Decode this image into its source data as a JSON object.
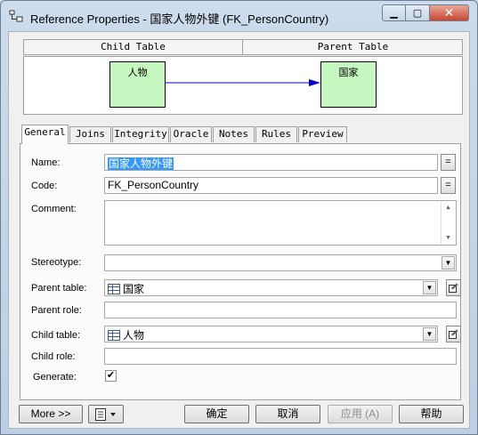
{
  "window": {
    "title": "Reference Properties - 国家人物外键 (FK_PersonCountry)",
    "minimize_glyph": "▁",
    "maximize_glyph": "▢",
    "close_glyph": "✕"
  },
  "diagram": {
    "child_header": "Child Table",
    "parent_header": "Parent Table",
    "child_entity": "人物",
    "parent_entity": "国家",
    "entity_fill": "#c6f7c0",
    "link_color": "#0000cc"
  },
  "tabs": [
    {
      "label": "General",
      "active": true
    },
    {
      "label": "Joins",
      "active": false
    },
    {
      "label": "Integrity",
      "active": false
    },
    {
      "label": "Oracle",
      "active": false
    },
    {
      "label": "Notes",
      "active": false
    },
    {
      "label": "Rules",
      "active": false
    },
    {
      "label": "Preview",
      "active": false
    }
  ],
  "form": {
    "name_label": "Name:",
    "name_value": "国家人物外键",
    "code_label": "Code:",
    "code_value": "FK_PersonCountry",
    "comment_label": "Comment:",
    "comment_value": "",
    "stereotype_label": "Stereotype:",
    "stereotype_value": "",
    "parent_table_label": "Parent table:",
    "parent_table_value": "国家",
    "parent_role_label": "Parent role:",
    "parent_role_value": "",
    "child_table_label": "Child table:",
    "child_table_value": "人物",
    "child_role_label": "Child role:",
    "child_role_value": "",
    "generate_label": "Generate:",
    "generate_checked": true,
    "equals_glyph": "=",
    "check_glyph": "✔"
  },
  "buttons": {
    "more": "More >>",
    "ok": "确定",
    "cancel": "取消",
    "apply": "应用 (A)",
    "help": "帮助"
  }
}
